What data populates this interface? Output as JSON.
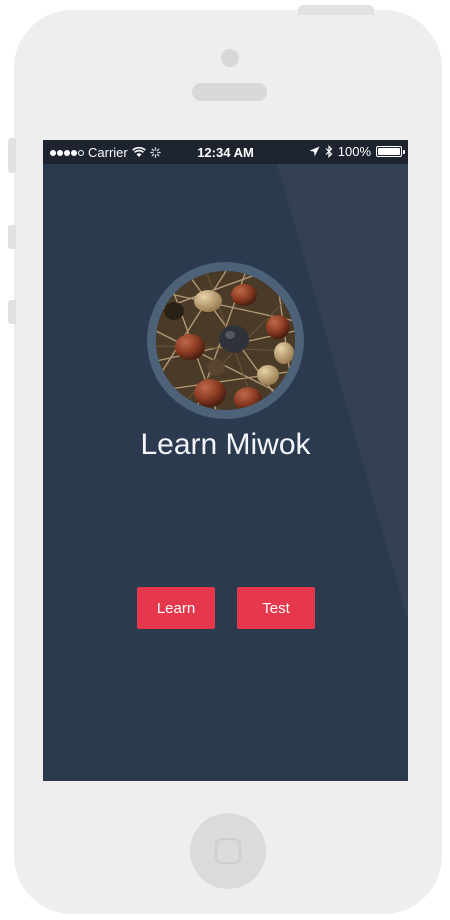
{
  "status_bar": {
    "carrier": "Carrier",
    "time": "12:34 AM",
    "battery": "100%",
    "icons": [
      "signal-dots-icon",
      "wifi-icon",
      "activity-spinner-icon",
      "location-arrow-icon",
      "bluetooth-icon",
      "battery-icon"
    ]
  },
  "main": {
    "logo_icon": "acorns-photo",
    "title": "Learn Miwok",
    "learn_label": "Learn",
    "test_label": "Test"
  },
  "colors": {
    "screen_background": "#2c3a50",
    "status_bar_background": "#1d2430",
    "button": "#e6384d",
    "device_body": "#efeeee"
  }
}
